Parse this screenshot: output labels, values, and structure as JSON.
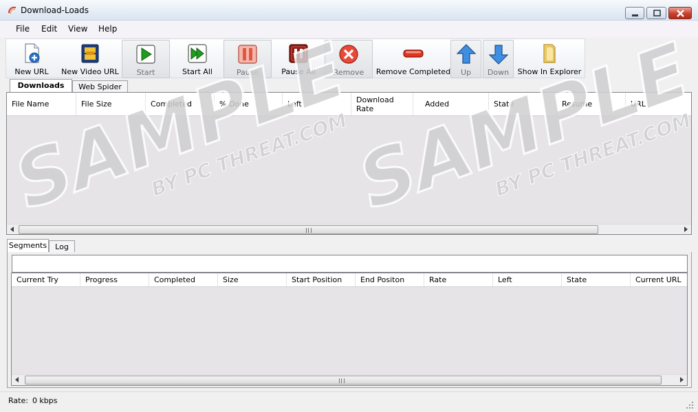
{
  "window": {
    "title": "Download-Loads"
  },
  "menu": [
    "File",
    "Edit",
    "View",
    "Help"
  ],
  "toolbar": {
    "new_url": "New URL",
    "new_video_url": "New Video URL",
    "start": "Start",
    "start_all": "Start All",
    "pause": "Pause",
    "pause_all": "Pause All",
    "remove": "Remove",
    "remove_completed": "Remove Completed",
    "up": "Up",
    "down": "Down",
    "show_in_explorer": "Show In Explorer"
  },
  "top_tabs": [
    "Downloads",
    "Web Spider"
  ],
  "downloads_columns": [
    "File Name",
    "File Size",
    "Completed",
    "% Done",
    "Left",
    "Download Rate",
    "Added",
    "State",
    "Resume",
    "URL"
  ],
  "bottom_tabs": [
    "Segments",
    "Log"
  ],
  "segments_columns": [
    "Current Try",
    "Progress",
    "Completed",
    "Size",
    "Start Position",
    "End Positon",
    "Rate",
    "Left",
    "State",
    "Current URL"
  ],
  "status": {
    "label": "Rate:",
    "value": "0 kbps"
  },
  "watermark": {
    "main": "SAMPLE",
    "sub": "BY PC THREAT.COM"
  },
  "colors": {
    "title_bg": "#dbe5f1",
    "list_bg": "#e7e4e8",
    "close_red": "#c8402e",
    "play_green": "#1f9b1f",
    "pause_red": "#c8342a"
  }
}
